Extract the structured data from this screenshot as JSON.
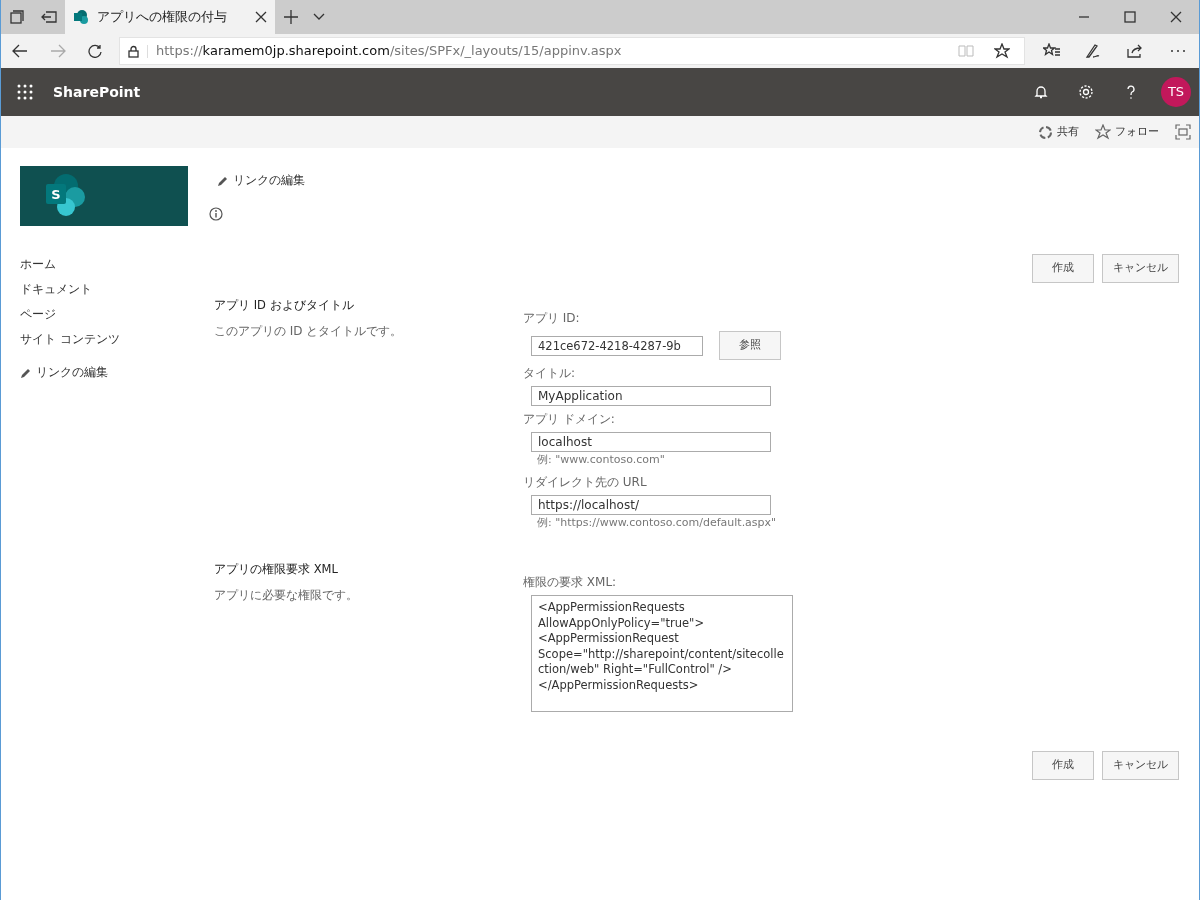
{
  "browser": {
    "tab": {
      "title": "アプリへの権限の付与",
      "selected": true
    },
    "url": {
      "scheme": "https://",
      "host": "karamem0jp.sharepoint.com",
      "path": "/sites/SPFx/_layouts/15/appinv.aspx"
    }
  },
  "suite_bar": {
    "app_name": "SharePoint",
    "avatar_initials": "TS"
  },
  "command_bar": {
    "actions": [
      {
        "kind": "share",
        "label": "共有"
      },
      {
        "kind": "follow",
        "label": "フォロー"
      }
    ]
  },
  "site_header": {
    "logo_letter": "S",
    "edit_links": "リンクの編集"
  },
  "nav": {
    "items": [
      {
        "label": "ホーム"
      },
      {
        "label": "ドキュメント"
      },
      {
        "label": "ページ"
      },
      {
        "label": "サイト コンテンツ"
      }
    ],
    "edit_links": "リンクの編集"
  },
  "buttons_top": [
    "作成",
    "キャンセル"
  ],
  "sections": [
    {
      "title": "アプリ ID およびタイトル",
      "description": "このアプリの ID とタイトルです。",
      "fields": [
        {
          "kind": "lookup",
          "label": "アプリ ID:",
          "value": "421ce672-4218-4287-9b",
          "button": "参照"
        },
        {
          "kind": "text",
          "label": "タイトル:",
          "value": "MyApplication"
        },
        {
          "kind": "text",
          "label": "アプリ ドメイン:",
          "value": "localhost",
          "example": "例: \"www.contoso.com\""
        },
        {
          "kind": "text",
          "label": "リダイレクト先の URL",
          "value": "https://localhost/",
          "example": "例: \"https://www.contoso.com/default.aspx\""
        }
      ]
    },
    {
      "title": "アプリの権限要求 XML",
      "description": "アプリに必要な権限です。",
      "fields": [
        {
          "kind": "textarea",
          "label": "権限の要求 XML:",
          "value": "<AppPermissionRequests AllowAppOnlyPolicy=\"true\">\n<AppPermissionRequest Scope=\"http://sharepoint/content/sitecollection/web\" Right=\"FullControl\" />\n</AppPermissionRequests>"
        }
      ]
    }
  ],
  "buttons_bottom": [
    "作成",
    "キャンセル"
  ]
}
